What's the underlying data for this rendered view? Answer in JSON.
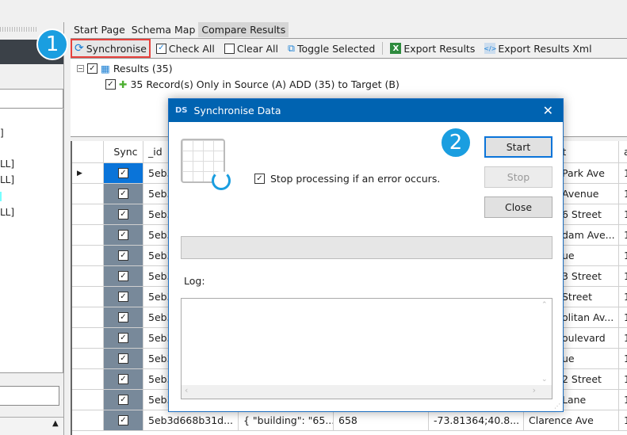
{
  "left_panel": {
    "fragments": [
      "]",
      "LL]",
      "LL]",
      "LL]"
    ]
  },
  "tabs": [
    {
      "label": "Start Page"
    },
    {
      "label": "Schema Map"
    },
    {
      "label": "Compare Results",
      "active": true
    }
  ],
  "toolbar": {
    "synchronise": "Synchronise",
    "check_all": "Check All",
    "clear_all": "Clear All",
    "toggle_selected": "Toggle Selected",
    "export_results": "Export Results",
    "export_results_xml": "Export Results Xml"
  },
  "tree": {
    "root": "Results (35)",
    "child": "35 Record(s) Only in Source (A) ADD (35) to Target (B)"
  },
  "grid": {
    "headers": [
      "Sync",
      "_id",
      "",
      "",
      "",
      "s|street",
      "a"
    ],
    "rows": [
      {
        "id": "5eb3",
        "street": "Park Ave",
        "a": "1"
      },
      {
        "id": "5eb3",
        "street": "Avenue",
        "a": "1"
      },
      {
        "id": "5eb3",
        "street": "6 Street",
        "a": "1"
      },
      {
        "id": "5eb3",
        "street": "dam Ave...",
        "a": "1"
      },
      {
        "id": "5eb3",
        "street": "ue",
        "a": "1"
      },
      {
        "id": "5eb3",
        "street": "3 Street",
        "a": "1"
      },
      {
        "id": "5eb3",
        "street": "Street",
        "a": "1"
      },
      {
        "id": "5eb3",
        "street": "olitan Av...",
        "a": "1"
      },
      {
        "id": "5eb3",
        "street": "oulevard",
        "a": "1"
      },
      {
        "id": "5eb3",
        "street": "ue",
        "a": "1"
      },
      {
        "id": "5eb3",
        "street": "2 Street",
        "a": "1"
      },
      {
        "id": "5eb3",
        "street": "Lane",
        "a": "1"
      },
      {
        "id": "5eb3d668b31d...",
        "addr": "{  \"building\": \"65...",
        "building": "658",
        "coord": "-73.81364;40.8...",
        "street": "Clarence Ave",
        "a": "1"
      }
    ]
  },
  "annotations": {
    "one": "1",
    "two": "2"
  },
  "dialog": {
    "title": "Synchronise Data",
    "stop_on_error": "Stop processing if an error occurs.",
    "stop_on_error_checked": true,
    "start": "Start",
    "stop": "Stop",
    "close": "Close",
    "log_label": "Log:",
    "log": "",
    "progress": 0
  },
  "colors": {
    "title_bar": "#0063b1",
    "badge": "#1a9ee0",
    "highlight": "#e8413c",
    "sync_col": "#78899a",
    "selected": "#0a74d9"
  }
}
